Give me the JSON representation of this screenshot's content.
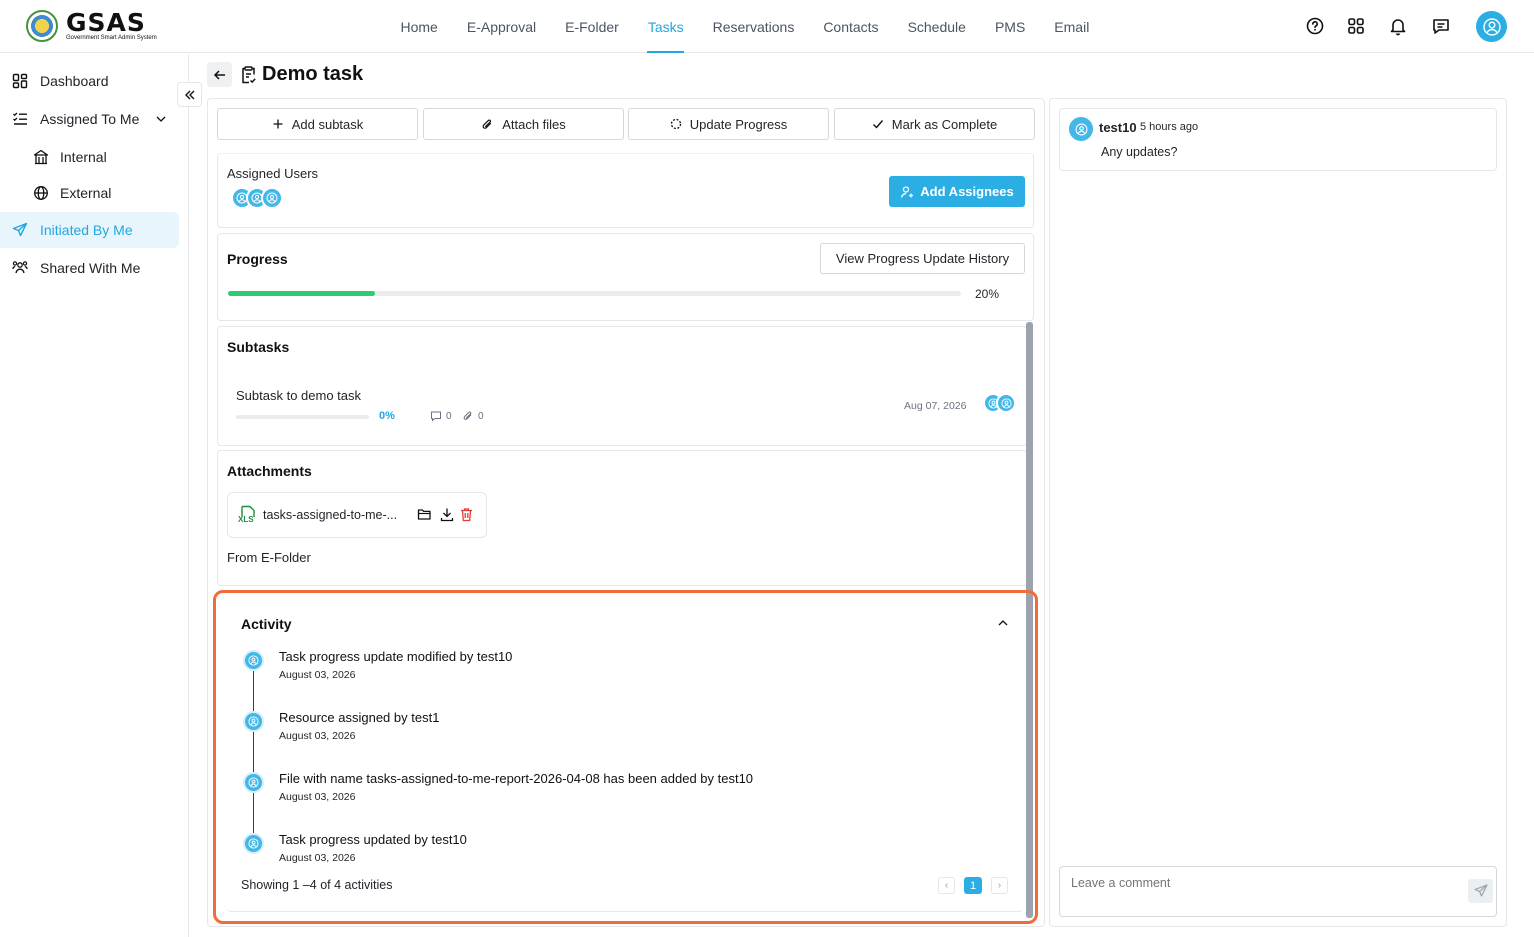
{
  "header": {
    "brand": "GSAS",
    "brand_sub": "Government Smart Admin System",
    "nav": [
      "Home",
      "E-Approval",
      "E-Folder",
      "Tasks",
      "Reservations",
      "Contacts",
      "Schedule",
      "PMS",
      "Email"
    ],
    "active_nav": "Tasks"
  },
  "sidebar": {
    "items": [
      {
        "label": "Dashboard",
        "icon": "dashboard-icon"
      },
      {
        "label": "Assigned To Me",
        "icon": "list-icon"
      },
      {
        "label": "Internal",
        "icon": "building-icon"
      },
      {
        "label": "External",
        "icon": "globe-icon"
      },
      {
        "label": "Initiated By Me",
        "icon": "send-icon"
      },
      {
        "label": "Shared With Me",
        "icon": "users-icon"
      }
    ],
    "active": "Initiated By Me"
  },
  "page": {
    "title": "Demo task"
  },
  "actions": {
    "add_subtask": "Add subtask",
    "attach_files": "Attach files",
    "update_progress": "Update Progress",
    "mark_complete": "Mark as Complete"
  },
  "assigned": {
    "title": "Assigned Users",
    "add_button": "Add Assignees"
  },
  "progress": {
    "title": "Progress",
    "history_button": "View Progress Update History",
    "value_label": "20%",
    "value": 20
  },
  "subtasks": {
    "title": "Subtasks",
    "items": [
      {
        "name": "Subtask to demo task",
        "progress_label": "0%",
        "comments": "0",
        "attachments": "0",
        "date": "Aug 07, 2026"
      }
    ]
  },
  "attachments": {
    "title": "Attachments",
    "file_name": "tasks-assigned-to-me-...",
    "file_type": "XLS",
    "source_label": "From E-Folder"
  },
  "activity": {
    "title": "Activity",
    "items": [
      {
        "text": "Task progress update modified by test10",
        "date": "August 03, 2026"
      },
      {
        "text": "Resource assigned by test1",
        "date": "August 03, 2026"
      },
      {
        "text": "File with name tasks-assigned-to-me-report-2026-04-08 has been added by test10",
        "date": "August 03, 2026"
      },
      {
        "text": "Task progress updated by test10",
        "date": "August 03, 2026"
      }
    ],
    "summary": "Showing 1 –4 of 4 activities",
    "current_page": "1",
    "prev": "‹",
    "next": "›"
  },
  "comments": {
    "items": [
      {
        "author": "test10",
        "time": "5 hours ago",
        "text": "Any updates?"
      }
    ],
    "input_placeholder": "Leave a comment"
  },
  "colors": {
    "accent": "#2aaee3",
    "progress": "#2ecc71",
    "highlight": "#f26b3a",
    "delete": "#e53935",
    "excel": "#1e8e3e"
  }
}
